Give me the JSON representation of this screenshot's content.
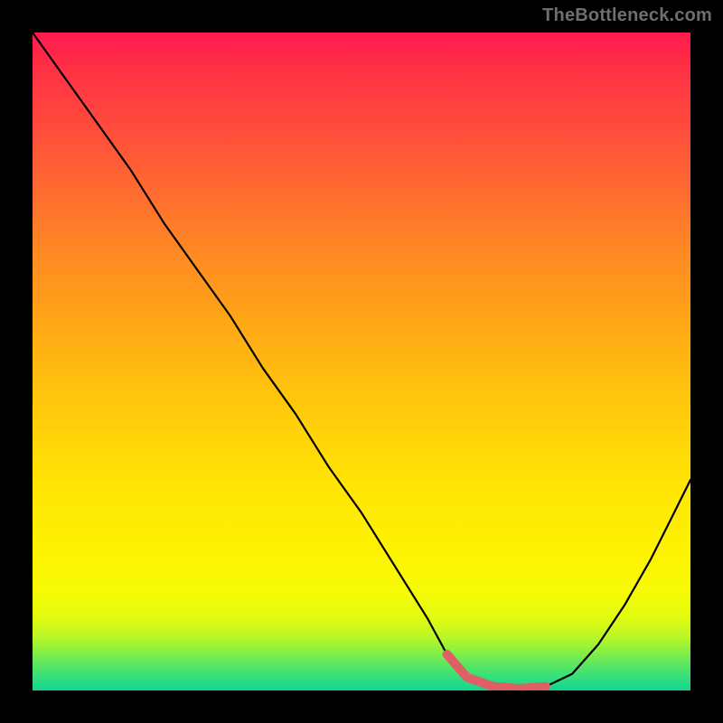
{
  "attribution": "TheBottleneck.com",
  "colors": {
    "frame": "#000000",
    "curve": "#000000",
    "highlight": "#de6064",
    "gradient_top": "#ff1a4e",
    "gradient_bottom": "#10d695"
  },
  "chart_data": {
    "type": "line",
    "title": "",
    "xlabel": "",
    "ylabel": "",
    "xlim": [
      0,
      100
    ],
    "ylim": [
      0,
      100
    ],
    "grid": false,
    "legend": false,
    "series": [
      {
        "name": "bottleneck-curve",
        "x": [
          0,
          5,
          10,
          15,
          20,
          25,
          30,
          35,
          40,
          45,
          50,
          55,
          60,
          63,
          66,
          70,
          74,
          78,
          82,
          86,
          90,
          94,
          97,
          100
        ],
        "values": [
          100,
          93,
          86,
          79,
          71,
          64,
          57,
          49,
          42,
          34,
          27,
          19,
          11,
          5.5,
          2,
          0.6,
          0.3,
          0.6,
          2.5,
          7,
          13,
          20,
          26,
          32
        ]
      }
    ],
    "highlight_region": {
      "name": "optimal-range",
      "x_start": 63,
      "x_end": 78,
      "y": 0.5
    },
    "background": {
      "type": "vertical-gradient",
      "description": "red at top through orange, yellow, to green at bottom",
      "stops": [
        {
          "pos": 0.0,
          "color": "#ff1a4e"
        },
        {
          "pos": 0.14,
          "color": "#ff4a3c"
        },
        {
          "pos": 0.34,
          "color": "#ff8a22"
        },
        {
          "pos": 0.55,
          "color": "#ffc40c"
        },
        {
          "pos": 0.79,
          "color": "#fdf302"
        },
        {
          "pos": 0.92,
          "color": "#b8f628"
        },
        {
          "pos": 1.0,
          "color": "#10d695"
        }
      ]
    }
  }
}
